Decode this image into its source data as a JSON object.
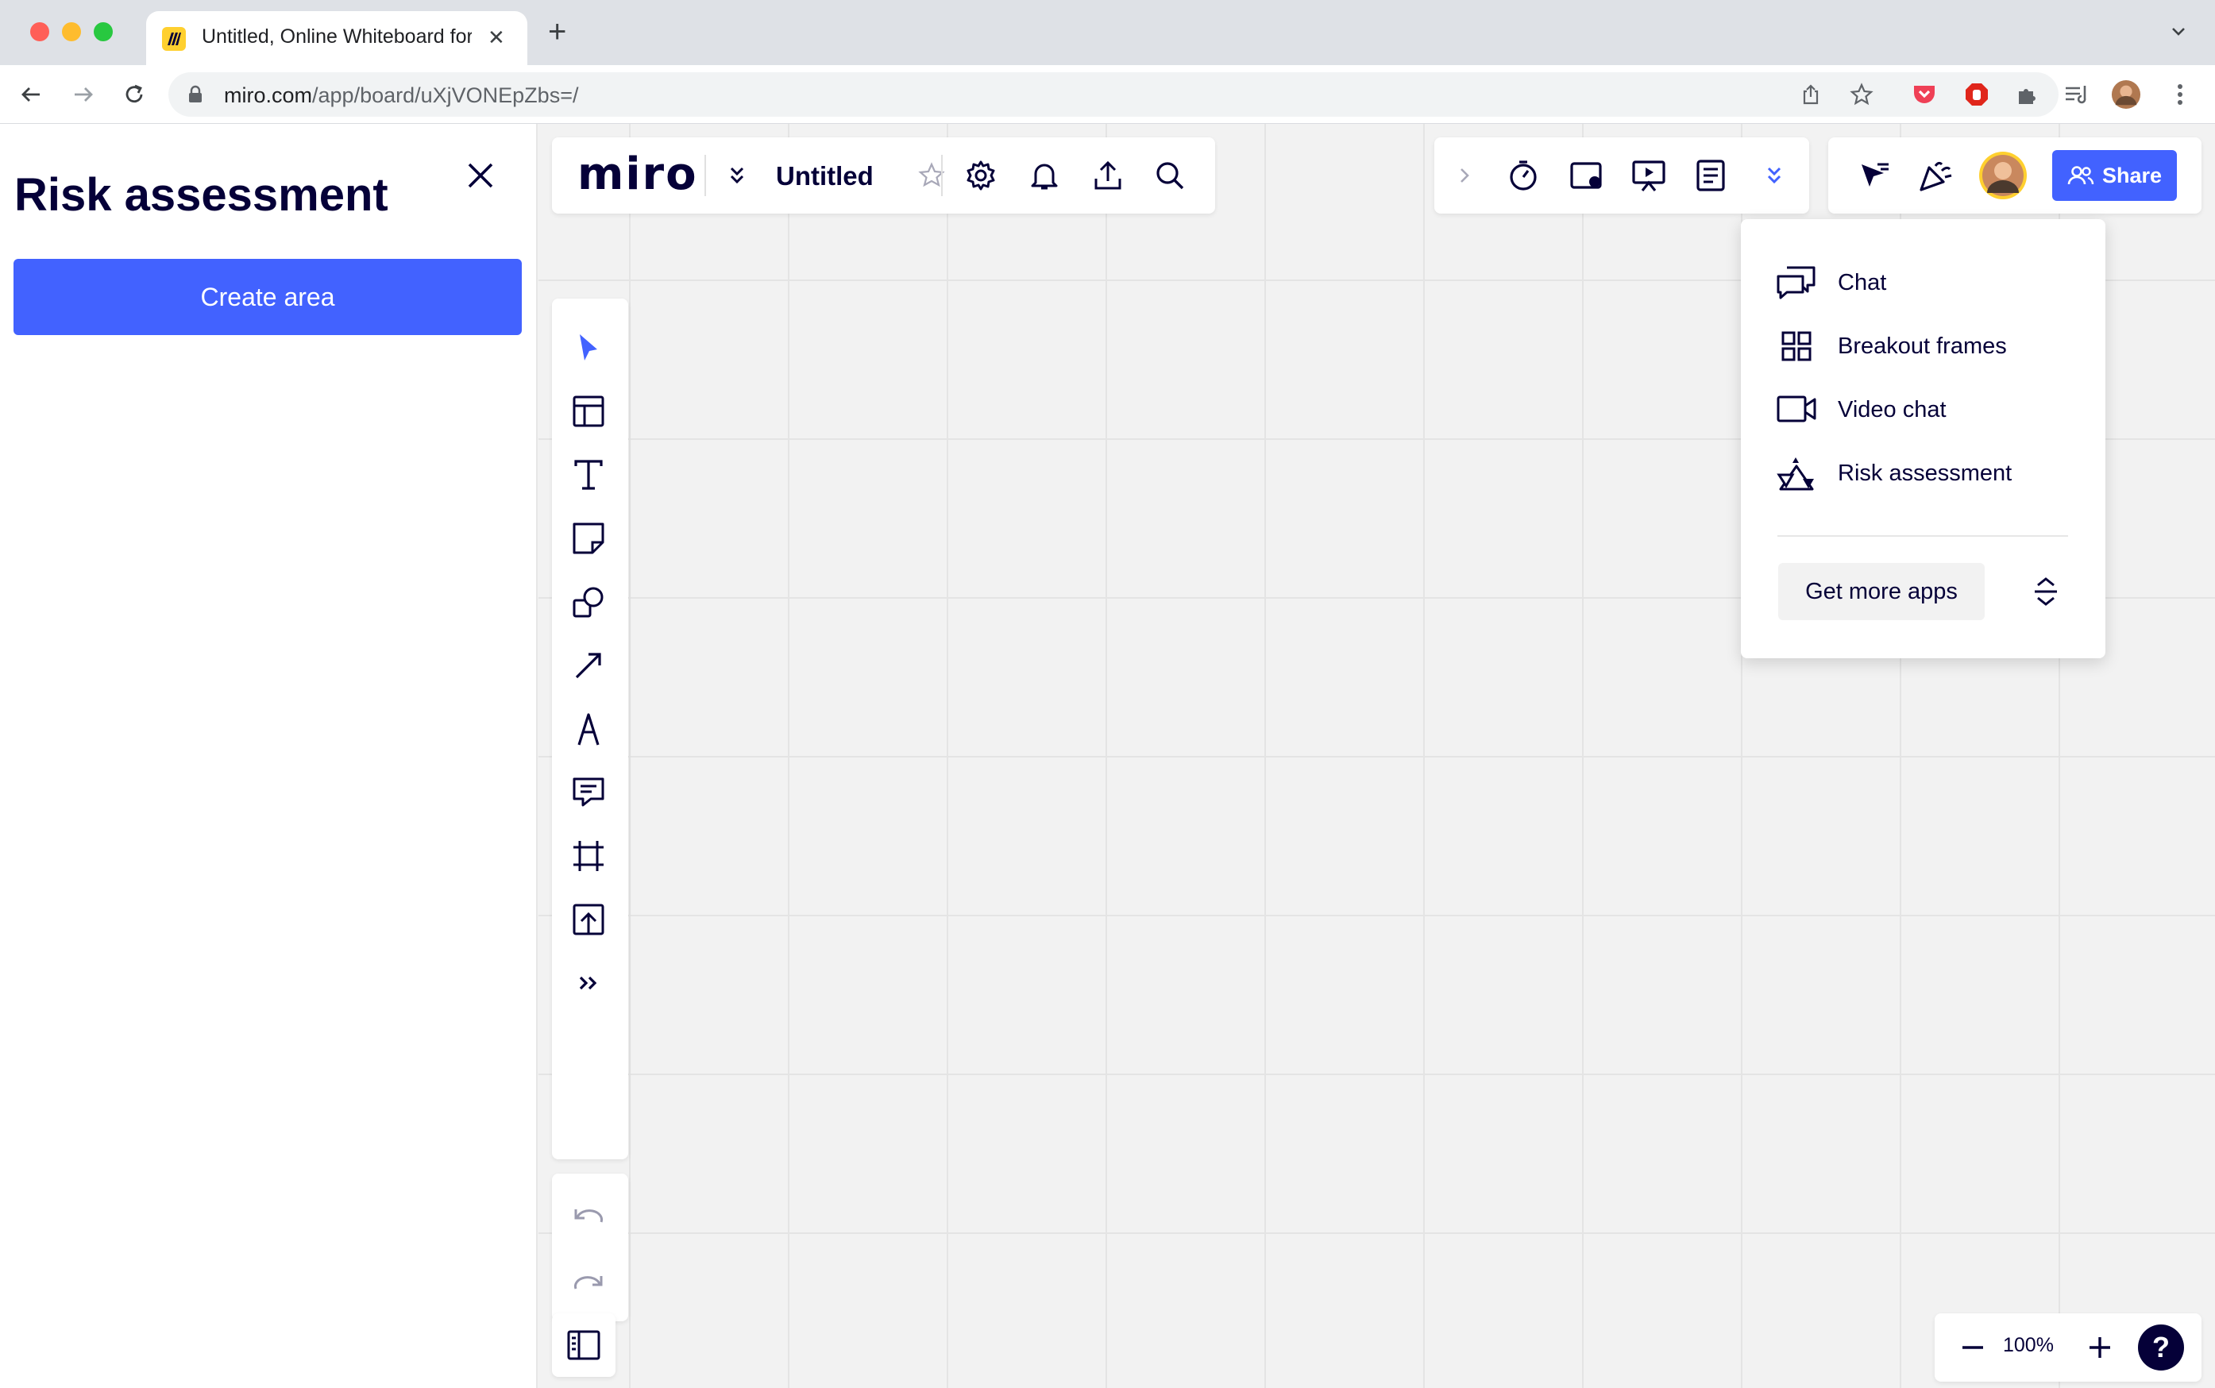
{
  "browser": {
    "tab_title": "Untitled, Online Whiteboard for Visual Collaboration",
    "tab_close": "✕",
    "new_tab": "+",
    "url_host": "miro.com",
    "url_path": "/app/board/uXjVONEpZbs=/"
  },
  "side_panel": {
    "title": "Risk assessment",
    "create_button": "Create area"
  },
  "board": {
    "logo": "miro",
    "title": "Untitled",
    "share_label": "Share"
  },
  "apps_menu": {
    "items": [
      {
        "label": "Chat",
        "icon": "chat-icon"
      },
      {
        "label": "Breakout frames",
        "icon": "breakout-frames-icon"
      },
      {
        "label": "Video chat",
        "icon": "video-chat-icon"
      },
      {
        "label": "Risk assessment",
        "icon": "risk-assessment-icon"
      }
    ],
    "get_more": "Get more apps"
  },
  "zoom": {
    "level": "100%",
    "help": "?"
  },
  "colors": {
    "accent": "#4262ff",
    "ink": "#050038",
    "canvas": "#f2f2f2"
  }
}
